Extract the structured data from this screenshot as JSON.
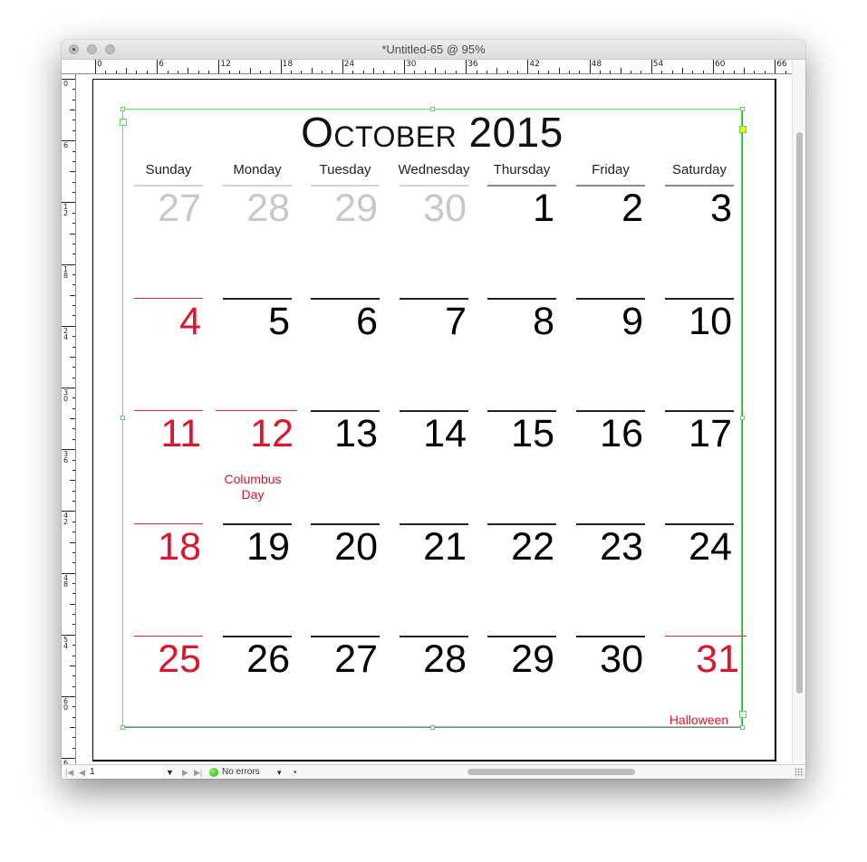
{
  "window": {
    "title": "*Untitled-65 @ 95%",
    "traffic_lights": [
      "close",
      "minimize",
      "zoom"
    ]
  },
  "rulers": {
    "horizontal_labels": [
      "0",
      "6",
      "12",
      "18",
      "24",
      "30",
      "36",
      "42",
      "48",
      "54",
      "60",
      "66"
    ],
    "vertical_labels": [
      "0",
      "6",
      "12",
      "18",
      "24",
      "30",
      "36",
      "42",
      "48",
      "54",
      "60",
      "6"
    ]
  },
  "calendar": {
    "title": "October 2015",
    "weekdays": [
      "Sunday",
      "Monday",
      "Tuesday",
      "Wednesday",
      "Thursday",
      "Friday",
      "Saturday"
    ],
    "weeks": [
      [
        {
          "d": "27",
          "t": "muted"
        },
        {
          "d": "28",
          "t": "muted"
        },
        {
          "d": "29",
          "t": "muted"
        },
        {
          "d": "30",
          "t": "muted"
        },
        {
          "d": "1",
          "t": "gray"
        },
        {
          "d": "2",
          "t": "gray"
        },
        {
          "d": "3",
          "t": "gray"
        }
      ],
      [
        {
          "d": "4",
          "t": "holiday"
        },
        {
          "d": "5",
          "t": ""
        },
        {
          "d": "6",
          "t": ""
        },
        {
          "d": "7",
          "t": ""
        },
        {
          "d": "8",
          "t": ""
        },
        {
          "d": "9",
          "t": ""
        },
        {
          "d": "10",
          "t": ""
        }
      ],
      [
        {
          "d": "11",
          "t": "holiday"
        },
        {
          "d": "12",
          "t": "holiday"
        },
        {
          "d": "13",
          "t": ""
        },
        {
          "d": "14",
          "t": ""
        },
        {
          "d": "15",
          "t": ""
        },
        {
          "d": "16",
          "t": ""
        },
        {
          "d": "17",
          "t": ""
        }
      ],
      [
        {
          "d": "18",
          "t": "holiday"
        },
        {
          "d": "19",
          "t": ""
        },
        {
          "d": "20",
          "t": ""
        },
        {
          "d": "21",
          "t": ""
        },
        {
          "d": "22",
          "t": ""
        },
        {
          "d": "23",
          "t": ""
        },
        {
          "d": "24",
          "t": ""
        }
      ],
      [
        {
          "d": "25",
          "t": "holiday"
        },
        {
          "d": "26",
          "t": ""
        },
        {
          "d": "27",
          "t": ""
        },
        {
          "d": "28",
          "t": ""
        },
        {
          "d": "29",
          "t": ""
        },
        {
          "d": "30",
          "t": ""
        },
        {
          "d": "31",
          "t": "holiday"
        }
      ]
    ],
    "notes": {
      "columbus_day_line1": "Columbus",
      "columbus_day_line2": "Day",
      "halloween": "Halloween"
    },
    "colors": {
      "holiday": "#d9172f",
      "muted": "#c8c8c8",
      "text": "#000000",
      "selection": "#5ce65c"
    }
  },
  "statusbar": {
    "page_number": "1",
    "preflight_status": "No errors",
    "status_color": "#21b10a"
  }
}
